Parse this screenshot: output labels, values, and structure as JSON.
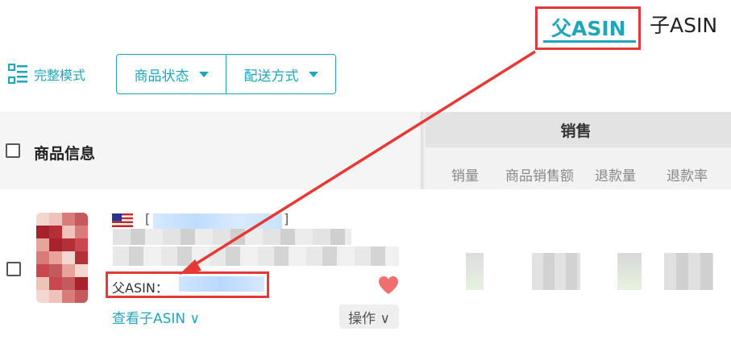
{
  "tabs": {
    "parent_asin": "父ASIN",
    "child_asin": "子ASIN"
  },
  "toolbar": {
    "mode_label": "完整模式",
    "filters": [
      "商品状态",
      "配送方式"
    ]
  },
  "table": {
    "product_info_header": "商品信息",
    "sales_group_header": "销售",
    "columns": [
      "销量",
      "商品销售额",
      "退款量",
      "退款率"
    ]
  },
  "row": {
    "bracket_open": "[",
    "bracket_close": "]",
    "asin_label": "父ASIN：",
    "view_child_link": "查看子ASIN ∨",
    "actions_button": "操作 ∨"
  },
  "colors": {
    "accent": "#1fa6b8",
    "annotation": "#e53935",
    "heart": "#f06e6e"
  },
  "icons": {
    "mode": "grid-list-icon",
    "flag": "us-flag-icon",
    "favorite": "heart-icon"
  }
}
